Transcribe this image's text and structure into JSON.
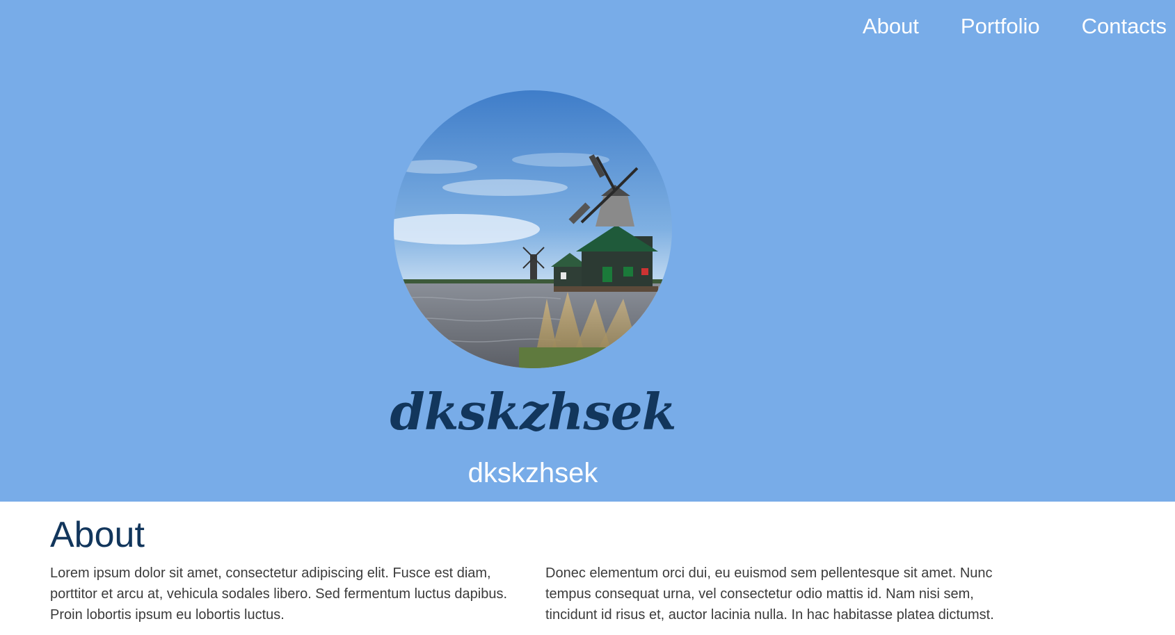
{
  "nav": {
    "items": [
      {
        "label": "About"
      },
      {
        "label": "Portfolio"
      },
      {
        "label": "Contacts"
      }
    ]
  },
  "hero": {
    "avatar_icon": "windmill-landscape-photo",
    "logo_text": "dkskzhsek",
    "subtitle": "dkskzhsek"
  },
  "about": {
    "heading": "About",
    "paragraph_left": "Lorem ipsum dolor sit amet, consectetur adipiscing elit. Fusce est diam, porttitor et arcu at, vehicula sodales libero. Sed fermentum luctus dapibus. Proin lobortis ipsum eu lobortis luctus.",
    "paragraph_right": "Donec elementum orci dui, eu euismod sem pellentesque sit amet. Nunc tempus consequat urna, vel consectetur odio mattis id. Nam nisi sem, tincidunt id risus et, auctor lacinia nulla. In hac habitasse platea dictumst."
  },
  "colors": {
    "hero_background": "#78ace8",
    "heading_navy": "#12365c",
    "body_text": "#3b3b3b",
    "nav_text": "#ffffff"
  }
}
